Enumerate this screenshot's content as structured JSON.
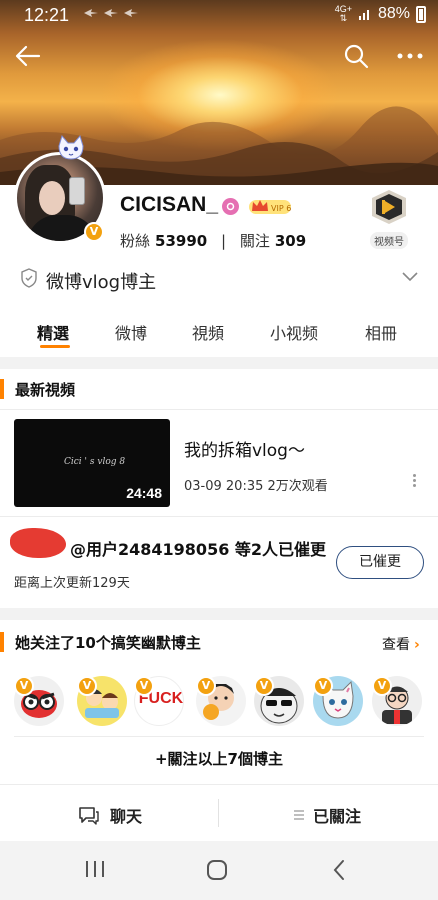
{
  "status_bar": {
    "time": "12:21",
    "network_top": "4G+",
    "network_bottom": "",
    "battery": "88%"
  },
  "header": {
    "back_icon": "arrow-left-icon",
    "search_icon": "search-icon",
    "more_icon": "more-horizontal-icon"
  },
  "profile": {
    "username": "CICISAN_",
    "vip_label": "VIP 6",
    "verified_mark": "V",
    "followers_label": "粉絲",
    "followers_count": "53990",
    "following_label": "關注",
    "following_count": "309",
    "separator": "|",
    "video_badge_label": "视频号"
  },
  "certification": {
    "label": "微博vlog博主"
  },
  "tabs": [
    {
      "label": "精選",
      "active": true
    },
    {
      "label": "微博",
      "active": false
    },
    {
      "label": "視頻",
      "active": false
    },
    {
      "label": "小视频",
      "active": false
    },
    {
      "label": "相冊",
      "active": false
    }
  ],
  "latest_video": {
    "section_title": "最新視頻",
    "thumb_script": "Cici ' s vlog 8",
    "duration": "24:48",
    "title": "我的拆箱vlog～",
    "meta": "03-09 20:35 2万次观看"
  },
  "reminder": {
    "text": "@用户2484198056 等2人已催更",
    "since": "距离上次更新129天",
    "button": "已催更"
  },
  "follows": {
    "section_title": "她关注了10个搞笑幽默博主",
    "more_label": "查看",
    "follow_all": "+關注以上7個博主",
    "avatars": [
      {
        "name": "angry-bird-avatar",
        "bg": "#f0f0f0"
      },
      {
        "name": "cartoon-kids-avatar",
        "bg": "#f7e36a"
      },
      {
        "name": "fuck-text-avatar",
        "bg": "#ffffff",
        "text": "FUCK"
      },
      {
        "name": "cartoon-boy-avatar",
        "bg": "#f3f3f3"
      },
      {
        "name": "sunglasses-avatar",
        "bg": "#e9e9e9"
      },
      {
        "name": "cat-avatar",
        "bg": "#a9d9ef"
      },
      {
        "name": "glasses-man-avatar",
        "bg": "#efefef"
      }
    ]
  },
  "bottom_actions": {
    "chat": "聊天",
    "followed": "已關注"
  },
  "colors": {
    "accent": "#ff8200",
    "verified": "#f3a10f",
    "button_border": "#2f4f80"
  }
}
